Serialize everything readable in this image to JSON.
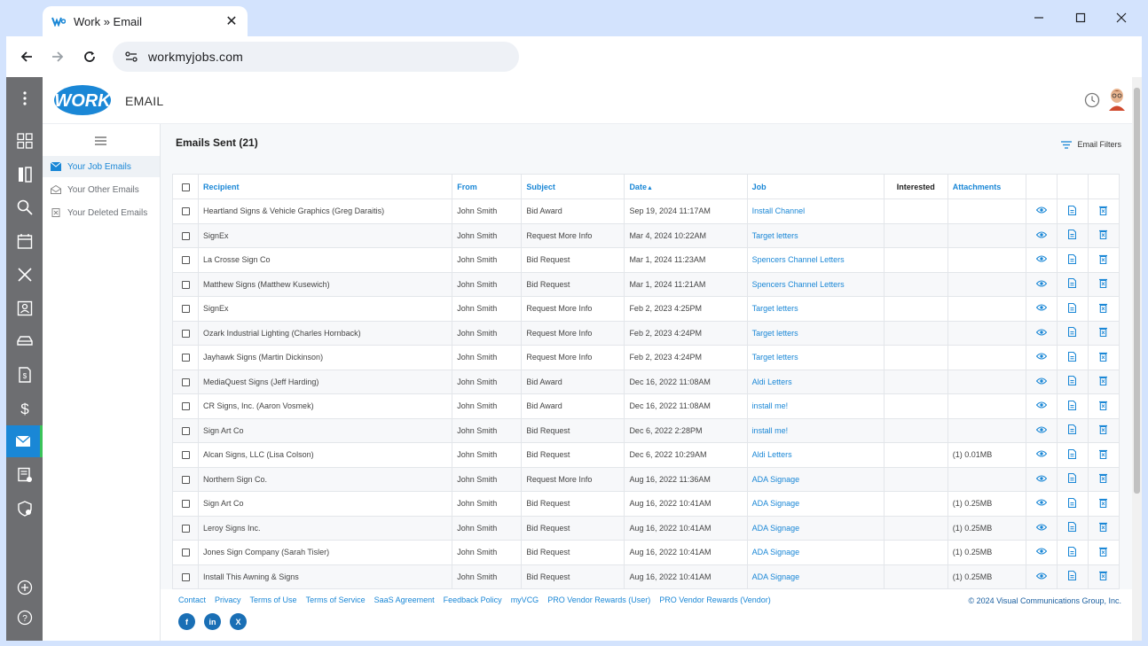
{
  "browser": {
    "tab_title": "Work » Email",
    "tab_close": "✕",
    "url": "workmyjobs.com"
  },
  "app": {
    "module_title": "EMAIL",
    "logo_text": "WORK"
  },
  "subnav": {
    "items": [
      {
        "label": "Your Job Emails",
        "active": true
      },
      {
        "label": "Your Other Emails",
        "active": false
      },
      {
        "label": "Your Deleted Emails",
        "active": false
      }
    ]
  },
  "content": {
    "title": "Emails Sent (21)",
    "filters_label": "Email Filters"
  },
  "table": {
    "columns": [
      "Recipient",
      "From",
      "Subject",
      "Date",
      "Job",
      "Interested",
      "Attachments"
    ],
    "rows": [
      {
        "recipient": "Heartland Signs & Vehicle Graphics (Greg Daraitis)",
        "from": "John Smith",
        "subject": "Bid Award",
        "date": "Sep 19, 2024 11:17AM",
        "job": "Install Channel",
        "interested": "",
        "attachments": ""
      },
      {
        "recipient": "SignEx",
        "from": "John Smith",
        "subject": "Request More Info",
        "date": "Mar 4, 2024 10:22AM",
        "job": "Target letters",
        "interested": "",
        "attachments": ""
      },
      {
        "recipient": "La Crosse Sign Co",
        "from": "John Smith",
        "subject": "Bid Request",
        "date": "Mar 1, 2024 11:23AM",
        "job": "Spencers Channel Letters",
        "interested": "",
        "attachments": ""
      },
      {
        "recipient": "Matthew Signs (Matthew Kusewich)",
        "from": "John Smith",
        "subject": "Bid Request",
        "date": "Mar 1, 2024 11:21AM",
        "job": "Spencers Channel Letters",
        "interested": "",
        "attachments": ""
      },
      {
        "recipient": "SignEx",
        "from": "John Smith",
        "subject": "Request More Info",
        "date": "Feb 2, 2023 4:25PM",
        "job": "Target letters",
        "interested": "",
        "attachments": ""
      },
      {
        "recipient": "Ozark Industrial Lighting (Charles Hornback)",
        "from": "John Smith",
        "subject": "Request More Info",
        "date": "Feb 2, 2023 4:24PM",
        "job": "Target letters",
        "interested": "",
        "attachments": ""
      },
      {
        "recipient": "Jayhawk Signs (Martin Dickinson)",
        "from": "John Smith",
        "subject": "Request More Info",
        "date": "Feb 2, 2023 4:24PM",
        "job": "Target letters",
        "interested": "",
        "attachments": ""
      },
      {
        "recipient": "MediaQuest Signs (Jeff Harding)",
        "from": "John Smith",
        "subject": "Bid Award",
        "date": "Dec 16, 2022 11:08AM",
        "job": "Aldi Letters",
        "interested": "",
        "attachments": ""
      },
      {
        "recipient": "CR Signs, Inc. (Aaron Vosmek)",
        "from": "John Smith",
        "subject": "Bid Award",
        "date": "Dec 16, 2022 11:08AM",
        "job": "install me!",
        "interested": "",
        "attachments": ""
      },
      {
        "recipient": "Sign Art Co",
        "from": "John Smith",
        "subject": "Bid Request",
        "date": "Dec 6, 2022 2:28PM",
        "job": "install me!",
        "interested": "",
        "attachments": ""
      },
      {
        "recipient": "Alcan Signs, LLC (Lisa Colson)",
        "from": "John Smith",
        "subject": "Bid Request",
        "date": "Dec 6, 2022 10:29AM",
        "job": "Aldi Letters",
        "interested": "",
        "attachments": "(1) 0.01MB"
      },
      {
        "recipient": "Northern Sign Co.",
        "from": "John Smith",
        "subject": "Request More Info",
        "date": "Aug 16, 2022 11:36AM",
        "job": "ADA Signage",
        "interested": "",
        "attachments": ""
      },
      {
        "recipient": "Sign Art Co",
        "from": "John Smith",
        "subject": "Bid Request",
        "date": "Aug 16, 2022 10:41AM",
        "job": "ADA Signage",
        "interested": "",
        "attachments": "(1) 0.25MB"
      },
      {
        "recipient": "Leroy Signs Inc.",
        "from": "John Smith",
        "subject": "Bid Request",
        "date": "Aug 16, 2022 10:41AM",
        "job": "ADA Signage",
        "interested": "",
        "attachments": "(1) 0.25MB"
      },
      {
        "recipient": "Jones Sign Company (Sarah Tisler)",
        "from": "John Smith",
        "subject": "Bid Request",
        "date": "Aug 16, 2022 10:41AM",
        "job": "ADA Signage",
        "interested": "",
        "attachments": "(1) 0.25MB"
      },
      {
        "recipient": "Install This Awning & Signs",
        "from": "John Smith",
        "subject": "Bid Request",
        "date": "Aug 16, 2022 10:41AM",
        "job": "ADA Signage",
        "interested": "",
        "attachments": "(1) 0.25MB"
      }
    ]
  },
  "footer": {
    "links": [
      "Contact",
      "Privacy",
      "Terms of Use",
      "Terms of Service",
      "SaaS Agreement",
      "Feedback Policy",
      "myVCG",
      "PRO Vendor Rewards (User)",
      "PRO Vendor Rewards (Vendor)"
    ],
    "copyright": "© 2024 Visual Communications Group, Inc.",
    "social_icons": [
      "facebook-icon",
      "linkedin-icon",
      "x-icon"
    ]
  },
  "colors": {
    "accent": "#1a87d6",
    "rail": "#6d6e71",
    "active_rail": "#1a87d6",
    "active_indicator": "#3ac35a"
  }
}
